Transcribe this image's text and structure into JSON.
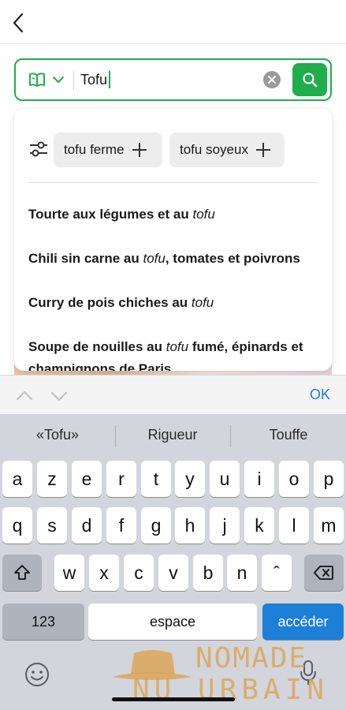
{
  "search": {
    "value": "Tofu",
    "book_icon": "recipe-book-icon",
    "chevron_icon": "chevron-down-icon",
    "clear_icon": "clear-icon",
    "submit_icon": "search-icon"
  },
  "chips": [
    {
      "label": "tofu ferme"
    },
    {
      "label": "tofu soyeux"
    }
  ],
  "suggestions": [
    {
      "pre": "Tourte aux légumes et au ",
      "match": "tofu",
      "post": ""
    },
    {
      "pre": "Chili sin carne au ",
      "match": "tofu",
      "post": ", tomates et poivrons"
    },
    {
      "pre": "Curry de pois chiches au ",
      "match": "tofu",
      "post": ""
    },
    {
      "pre": "Soupe de nouilles au ",
      "match": "tofu",
      "post": " fumé, épinards et"
    },
    {
      "pre": "champignons de Paris",
      "match": "",
      "post": ""
    }
  ],
  "accessory": {
    "ok_label": "OK"
  },
  "keyboard": {
    "predictions": [
      "«Tofu»",
      "Rigueur",
      "Touffe"
    ],
    "row1": [
      "a",
      "z",
      "e",
      "r",
      "t",
      "y",
      "u",
      "i",
      "o",
      "p"
    ],
    "row2": [
      "q",
      "s",
      "d",
      "f",
      "g",
      "h",
      "j",
      "k",
      "l",
      "m"
    ],
    "row3": [
      "w",
      "x",
      "c",
      "v",
      "b",
      "n",
      "ˆ"
    ],
    "numbers_label": "123",
    "space_label": "espace",
    "go_label": "accéder"
  },
  "watermark": {
    "line1": "NOMADE",
    "line2": "NU URBAIN"
  },
  "colors": {
    "accent": "#1fae4b",
    "ios_blue": "#1d7fd6"
  }
}
